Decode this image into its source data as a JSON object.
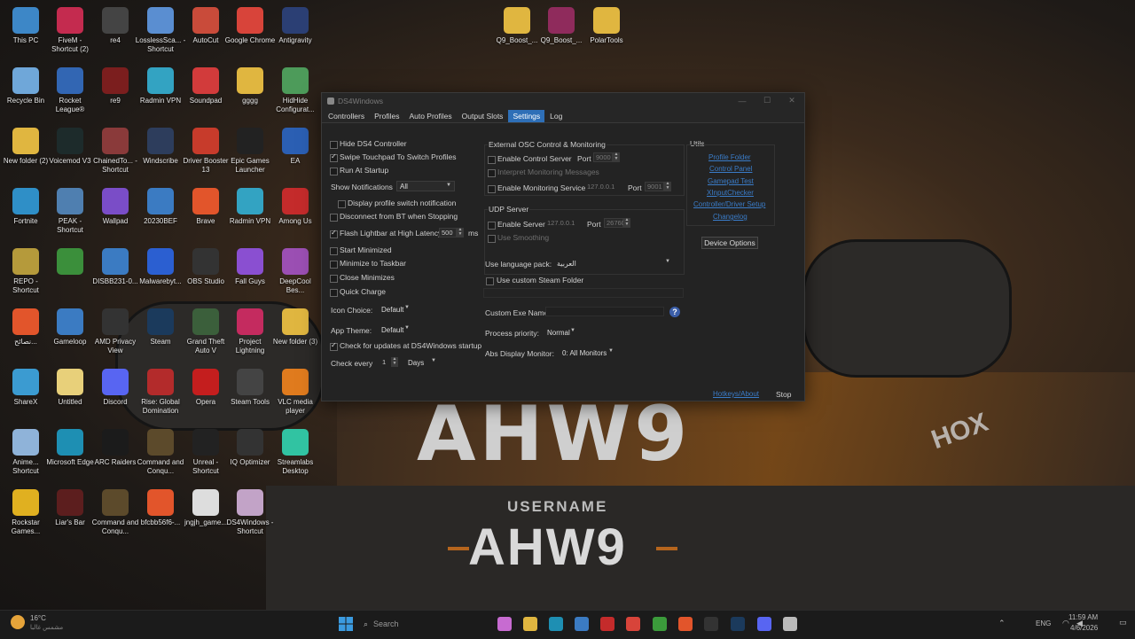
{
  "desktop": {
    "icons": [
      {
        "label": "This PC",
        "name": "this-pc-icon",
        "color": "#3d87c7"
      },
      {
        "label": "FiveM - Shortcut (2)",
        "name": "fivem-icon",
        "color": "#c42b4f"
      },
      {
        "label": "re4",
        "name": "re4-icon",
        "color": "#444444"
      },
      {
        "label": "LosslessSca... - Shortcut",
        "name": "lossless-scaling-icon",
        "color": "#5a8ed1"
      },
      {
        "label": "AutoCut",
        "name": "autocut-icon",
        "color": "#c94b3a"
      },
      {
        "label": "Google Chrome",
        "name": "chrome-icon",
        "color": "#d8443a"
      },
      {
        "label": "Antigravity",
        "name": "antigravity-icon",
        "color": "#2b3f74"
      },
      {
        "label": "Recycle Bin",
        "name": "recycle-bin-icon",
        "color": "#6fa7d9"
      },
      {
        "label": "Rocket League®",
        "name": "rocket-league-icon",
        "color": "#3266b3"
      },
      {
        "label": "re9",
        "name": "re9-icon",
        "color": "#7b1e1e"
      },
      {
        "label": "Radmin VPN",
        "name": "radmin-vpn-icon",
        "color": "#33a3c2"
      },
      {
        "label": "Soundpad",
        "name": "soundpad-icon",
        "color": "#d23b3b"
      },
      {
        "label": "gggg",
        "name": "folder-icon",
        "color": "#e0b640"
      },
      {
        "label": "HidHide Configurat...",
        "name": "hidhide-icon",
        "color": "#4d9b5a"
      },
      {
        "label": "New folder (2)",
        "name": "folder-icon",
        "color": "#e0b640"
      },
      {
        "label": "Voicemod V3",
        "name": "voicemod-icon",
        "color": "#1d2b2b"
      },
      {
        "label": "ChainedTo... - Shortcut",
        "name": "chained-icon",
        "color": "#8a3a3a"
      },
      {
        "label": "Windscribe",
        "name": "windscribe-icon",
        "color": "#2d3d5c"
      },
      {
        "label": "Driver Booster 13",
        "name": "driver-booster-icon",
        "color": "#c73b2b"
      },
      {
        "label": "Epic Games Launcher",
        "name": "epic-games-icon",
        "color": "#222222"
      },
      {
        "label": "EA",
        "name": "ea-icon",
        "color": "#2b5fb3"
      },
      {
        "label": "Fortnite",
        "name": "fortnite-icon",
        "color": "#2f8fc7"
      },
      {
        "label": "PEAK - Shortcut",
        "name": "peak-icon",
        "color": "#4f7fb0"
      },
      {
        "label": "Wallpad",
        "name": "wallpad-icon",
        "color": "#7a4dc7"
      },
      {
        "label": "20230BEF",
        "name": "image-file-icon",
        "color": "#3b7bc2"
      },
      {
        "label": "Brave",
        "name": "brave-icon",
        "color": "#e2552b"
      },
      {
        "label": "Radmin VPN",
        "name": "radmin-vpn-icon",
        "color": "#33a3c2"
      },
      {
        "label": "Among Us",
        "name": "among-us-icon",
        "color": "#c42b2b"
      },
      {
        "label": "REPO - Shortcut",
        "name": "repo-icon",
        "color": "#b59a3b"
      },
      {
        "label": "",
        "name": "game-icon",
        "color": "#3b8f3b"
      },
      {
        "label": "DISBB231-0...",
        "name": "image-file-icon",
        "color": "#3b7bc2"
      },
      {
        "label": "Malwarebyt...",
        "name": "malwarebytes-icon",
        "color": "#2b5fd1"
      },
      {
        "label": "OBS Studio",
        "name": "obs-icon",
        "color": "#333333"
      },
      {
        "label": "Fall Guys",
        "name": "fall-guys-icon",
        "color": "#8a4fd1"
      },
      {
        "label": "DeepCool Bes...",
        "name": "deepcool-icon",
        "color": "#9b4fb3"
      },
      {
        "label": "نصائح...",
        "name": "brave-file-icon",
        "color": "#e2552b"
      },
      {
        "label": "Gameloop",
        "name": "gameloop-icon",
        "color": "#3b7bc2"
      },
      {
        "label": "AMD Privacy View",
        "name": "amd-icon",
        "color": "#333333"
      },
      {
        "label": "Steam",
        "name": "steam-icon",
        "color": "#1b3a5c"
      },
      {
        "label": "Grand Theft Auto V",
        "name": "gta-icon",
        "color": "#3b5f3b"
      },
      {
        "label": "Project Lightning",
        "name": "lightning-icon",
        "color": "#c42b5f"
      },
      {
        "label": "New folder (3)",
        "name": "folder-icon",
        "color": "#e0b640"
      },
      {
        "label": "ShareX",
        "name": "sharex-icon",
        "color": "#3b9bd1"
      },
      {
        "label": "Untitled",
        "name": "file-icon",
        "color": "#e8d07a"
      },
      {
        "label": "Discord",
        "name": "discord-icon",
        "color": "#5865f2"
      },
      {
        "label": "Rise: Global Domination",
        "name": "rise-icon",
        "color": "#b32b2b"
      },
      {
        "label": "Opera",
        "name": "opera-icon",
        "color": "#c41e1e"
      },
      {
        "label": "Steam Tools",
        "name": "steam-tools-icon",
        "color": "#444444"
      },
      {
        "label": "VLC media player",
        "name": "vlc-icon",
        "color": "#e07b1e"
      },
      {
        "label": "Anime... Shortcut",
        "name": "anime-icon",
        "color": "#8fb3d9"
      },
      {
        "label": "Microsoft Edge",
        "name": "edge-icon",
        "color": "#1e8fb3"
      },
      {
        "label": "ARC Raiders",
        "name": "arc-raiders-icon",
        "color": "#1b1b1b"
      },
      {
        "label": "Command and Conqu...",
        "name": "command-conquer-icon",
        "color": "#5c4a2b"
      },
      {
        "label": "Unreal - Shortcut",
        "name": "unreal-icon",
        "color": "#222222"
      },
      {
        "label": "IQ Optimizer",
        "name": "iq-optimizer-icon",
        "color": "#333333"
      },
      {
        "label": "Streamlabs Desktop",
        "name": "streamlabs-icon",
        "color": "#31c3a2"
      },
      {
        "label": "Rockstar Games...",
        "name": "rockstar-icon",
        "color": "#e0b020"
      },
      {
        "label": "Liar's Bar",
        "name": "liars-bar-icon",
        "color": "#5c1e1e"
      },
      {
        "label": "Command and Conqu...",
        "name": "command-conquer-icon",
        "color": "#5c4a2b"
      },
      {
        "label": "bfcbb56f6-...",
        "name": "brave-file-icon",
        "color": "#e2552b"
      },
      {
        "label": "jngjh_game...",
        "name": "file-icon",
        "color": "#dddddd"
      },
      {
        "label": "DS4Windows - Shortcut",
        "name": "ds4windows-icon",
        "color": "#c2a3c7"
      },
      {
        "label": "Q9_Boost_...",
        "name": "folder-icon",
        "color": "#e0b640"
      },
      {
        "label": "Q9_Boost_...",
        "name": "winrar-icon",
        "color": "#8f2b5c"
      },
      {
        "label": "PolarTools",
        "name": "folder-icon",
        "color": "#e0b640"
      }
    ]
  },
  "wallpaper": {
    "big_text": "AHW9",
    "username_label": "USERNAME",
    "name_text": "AHW9",
    "hox": "HOX"
  },
  "window": {
    "title": "DS4Windows",
    "tabs": [
      "Controllers",
      "Profiles",
      "Auto Profiles",
      "Output Slots",
      "Settings",
      "Log"
    ],
    "active_tab": "Settings",
    "left": {
      "hide_ds4": "Hide DS4 Controller",
      "swipe_touchpad": "Swipe Touchpad To Switch Profiles",
      "run_at_startup": "Run At Startup",
      "show_notifications_label": "Show Notifications",
      "show_notifications_value": "All",
      "display_profile_switch": "Display profile switch notification",
      "disconnect_bt": "Disconnect from BT when Stopping",
      "flash_lightbar": "Flash Lightbar at High Latency",
      "latency_value": "500",
      "latency_unit": "ms",
      "start_minimized": "Start Minimized",
      "minimize_taskbar": "Minimize to Taskbar",
      "close_minimizes": "Close Minimizes",
      "quick_charge": "Quick Charge",
      "icon_choice_label": "Icon Choice:",
      "icon_choice_value": "Default",
      "app_theme_label": "App Theme:",
      "app_theme_value": "Default",
      "check_updates": "Check for updates at DS4Windows startup",
      "check_every_label": "Check every",
      "check_every_value": "1",
      "check_every_unit": "Days"
    },
    "osc": {
      "group_label": "External OSC Control & Monitoring",
      "enable_control_server": "Enable Control Server",
      "port_label": "Port",
      "control_port": "9000",
      "interpret_monitoring": "Interpret Monitoring Messages",
      "enable_monitoring": "Enable Monitoring Service",
      "monitoring_ip": "127.0.0.1",
      "monitoring_port_label": "Port",
      "monitoring_port": "9001"
    },
    "udp": {
      "group_label": "UDP Server",
      "enable_server": "Enable Server",
      "server_ip": "127.0.0.1",
      "port_label": "Port",
      "port_value": "26760",
      "use_smoothing": "Use Smoothing"
    },
    "lang": {
      "label": "Use language pack:",
      "value": "العربية",
      "custom_steam": "Use custom Steam Folder",
      "custom_exe_label": "Custom Exe Name",
      "custom_exe_value": "",
      "help": "?",
      "priority_label": "Process priority:",
      "priority_value": "Normal",
      "abs_display_label": "Abs Display Monitor:",
      "abs_display_value": "0: All Monitors"
    },
    "utils": {
      "label": "Utils",
      "links": [
        "Profile Folder",
        "Control Panel",
        "Gamepad Test",
        "XInputChecker",
        "Controller/Driver Setup",
        "Changelog"
      ],
      "device_options": "Device Options"
    },
    "footer": {
      "hotkeys": "Hotkeys/About",
      "stop": "Stop"
    }
  },
  "taskbar": {
    "weather_temp": "16°C",
    "weather_desc": "مشمس غالبا",
    "search_placeholder": "Search",
    "lang": "ENG",
    "time": "11:59 AM",
    "date": "4/6/2026"
  }
}
